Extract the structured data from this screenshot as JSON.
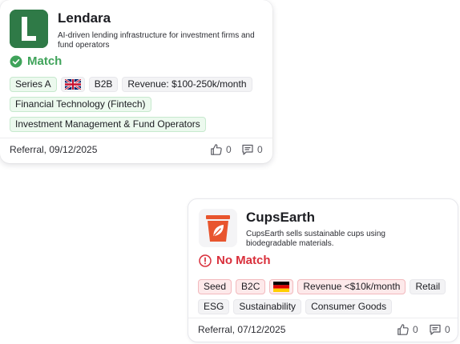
{
  "colors": {
    "match": "#3fa35a",
    "no_match": "#d92f3b",
    "lendara_logo_bg": "#2f7a47",
    "cupsearth_logo": "#e8552e"
  },
  "cards": [
    {
      "logo_icon": "lendara-logo-icon",
      "logo_letter": "L",
      "title": "Lendara",
      "description": "AI-driven lending infrastructure for investment firms and fund operators",
      "status": "Match",
      "status_icon": "check-circle-icon",
      "tags": {
        "stage": "Series A",
        "flag": "uk-flag-icon",
        "model": "B2B",
        "revenue": "Revenue: $100-250k/month",
        "sector_1": "Financial Technology (Fintech)",
        "sector_2": "Investment Management & Fund Operators"
      },
      "footer": {
        "date": "Referral, 09/12/2025",
        "likes": "0",
        "comments": "0"
      }
    },
    {
      "logo_icon": "cup-leaf-icon",
      "title": "CupsEarth",
      "description": "CupsEarth sells sustainable cups using biodegradable materials.",
      "status": "No Match",
      "status_icon": "alert-circle-icon",
      "tags": {
        "stage": "Seed",
        "model": "B2C",
        "flag": "germany-flag-icon",
        "revenue": "Revenue <$10k/month",
        "sector_1": "Retail",
        "sector_2": "ESG",
        "sector_3": "Sustainability",
        "sector_4": "Consumer Goods"
      },
      "footer": {
        "date": "Referral, 07/12/2025",
        "likes": "0",
        "comments": "0"
      }
    }
  ]
}
